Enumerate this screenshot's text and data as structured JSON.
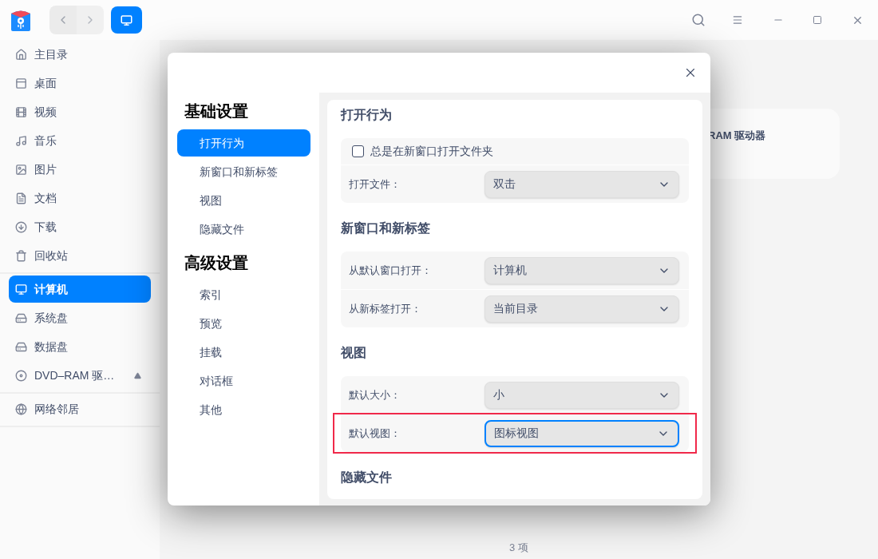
{
  "sidebar": {
    "groups": [
      {
        "items": [
          {
            "label": "主目录",
            "selected": false,
            "ejectable": false
          },
          {
            "label": "桌面",
            "selected": false,
            "ejectable": false
          },
          {
            "label": "视频",
            "selected": false,
            "ejectable": false
          },
          {
            "label": "音乐",
            "selected": false,
            "ejectable": false
          },
          {
            "label": "图片",
            "selected": false,
            "ejectable": false
          },
          {
            "label": "文档",
            "selected": false,
            "ejectable": false
          },
          {
            "label": "下载",
            "selected": false,
            "ejectable": false
          },
          {
            "label": "回收站",
            "selected": false,
            "ejectable": false
          }
        ]
      },
      {
        "items": [
          {
            "label": "计算机",
            "selected": true,
            "ejectable": false
          },
          {
            "label": "系统盘",
            "selected": false,
            "ejectable": false
          },
          {
            "label": "数据盘",
            "selected": false,
            "ejectable": false
          },
          {
            "label": "DVD–RAM 驱…",
            "selected": false,
            "ejectable": true
          }
        ]
      },
      {
        "items": [
          {
            "label": "网络邻居",
            "selected": false,
            "ejectable": false
          }
        ]
      }
    ]
  },
  "main": {
    "drive_card": {
      "label": "RAM 驱动器"
    },
    "status": "3 项"
  },
  "dialog": {
    "nav": [
      {
        "heading": "基础设置",
        "items": [
          {
            "label": "打开行为",
            "selected": true
          },
          {
            "label": "新窗口和新标签",
            "selected": false
          },
          {
            "label": "视图",
            "selected": false
          },
          {
            "label": "隐藏文件",
            "selected": false
          }
        ]
      },
      {
        "heading": "高级设置",
        "items": [
          {
            "label": "索引",
            "selected": false
          },
          {
            "label": "预览",
            "selected": false
          },
          {
            "label": "挂载",
            "selected": false
          },
          {
            "label": "对话框",
            "selected": false
          },
          {
            "label": "其他",
            "selected": false
          }
        ]
      }
    ],
    "sections": [
      {
        "title": "打开行为",
        "rows": [
          {
            "kind": "checkbox",
            "label": "总是在新窗口打开文件夹",
            "checked": false
          },
          {
            "kind": "select",
            "label": "打开文件：",
            "value": "双击",
            "focused": false,
            "highlighted": false
          }
        ]
      },
      {
        "title": "新窗口和新标签",
        "rows": [
          {
            "kind": "select",
            "label": "从默认窗口打开：",
            "value": "计算机",
            "focused": false,
            "highlighted": false
          },
          {
            "kind": "select",
            "label": "从新标签打开：",
            "value": "当前目录",
            "focused": false,
            "highlighted": false
          }
        ]
      },
      {
        "title": "视图",
        "rows": [
          {
            "kind": "select",
            "label": "默认大小：",
            "value": "小",
            "focused": false,
            "highlighted": false
          },
          {
            "kind": "select",
            "label": "默认视图：",
            "value": "图标视图",
            "focused": true,
            "highlighted": true
          }
        ]
      },
      {
        "title": "隐藏文件"
      }
    ]
  }
}
